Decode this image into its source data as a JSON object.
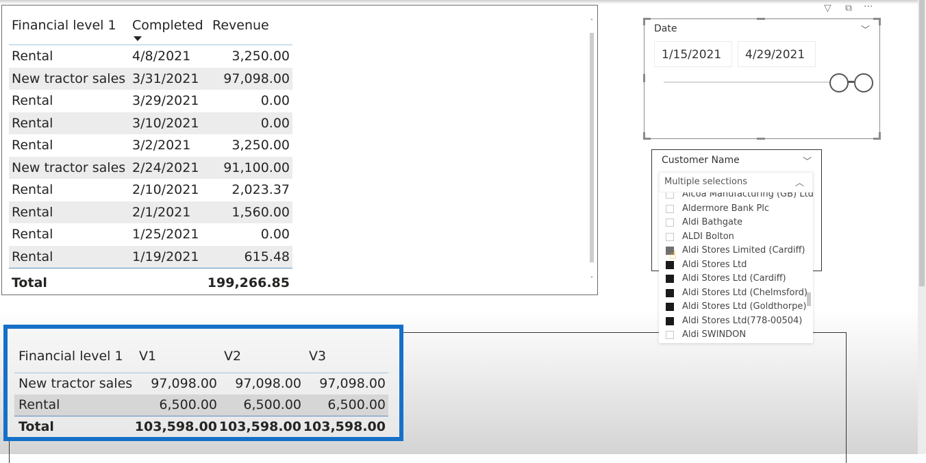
{
  "main_table": {
    "columns": [
      "Financial level 1",
      "Completed",
      "Revenue"
    ],
    "sorted_column": "Completed",
    "rows": [
      {
        "level": "Rental",
        "completed": "4/8/2021",
        "revenue": "3,250.00"
      },
      {
        "level": "New tractor sales",
        "completed": "3/31/2021",
        "revenue": "97,098.00"
      },
      {
        "level": "Rental",
        "completed": "3/29/2021",
        "revenue": "0.00"
      },
      {
        "level": "Rental",
        "completed": "3/10/2021",
        "revenue": "0.00"
      },
      {
        "level": "Rental",
        "completed": "3/2/2021",
        "revenue": "3,250.00"
      },
      {
        "level": "New tractor sales",
        "completed": "2/24/2021",
        "revenue": "91,100.00"
      },
      {
        "level": "Rental",
        "completed": "2/10/2021",
        "revenue": "2,023.37"
      },
      {
        "level": "Rental",
        "completed": "2/1/2021",
        "revenue": "1,560.00"
      },
      {
        "level": "Rental",
        "completed": "1/25/2021",
        "revenue": "0.00"
      },
      {
        "level": "Rental",
        "completed": "1/19/2021",
        "revenue": "615.48"
      }
    ],
    "total_label": "Total",
    "total_revenue": "199,266.85"
  },
  "date_slicer": {
    "title": "Date",
    "start": "1/15/2021",
    "end": "4/29/2021",
    "icons": [
      "filter-icon",
      "focus-mode-icon",
      "more-options-icon"
    ],
    "icon_glyphs": {
      "filter": "▽",
      "focus": "⧉",
      "more": "···"
    }
  },
  "customer_slicer": {
    "title": "Customer Name",
    "dropdown_value": "Multiple selections",
    "items": [
      {
        "label": "Alcoa Manufacturing (GB) Ltd",
        "state": "off"
      },
      {
        "label": "Aldermore Bank Plc",
        "state": "off"
      },
      {
        "label": "Aldi Bathgate",
        "state": "off"
      },
      {
        "label": "ALDI Bolton",
        "state": "off"
      },
      {
        "label": "Aldi Stores Limited (Cardiff)",
        "state": "hover"
      },
      {
        "label": "Aldi Stores Ltd",
        "state": "on"
      },
      {
        "label": "Aldi Stores Ltd (Cardiff)",
        "state": "on"
      },
      {
        "label": "Aldi Stores Ltd (Chelmsford)",
        "state": "on"
      },
      {
        "label": "Aldi Stores Ltd (Goldthorpe)",
        "state": "on"
      },
      {
        "label": "Aldi Stores Ltd(778-00504)",
        "state": "on"
      },
      {
        "label": "Aldi SWINDON",
        "state": "off"
      }
    ]
  },
  "summary_table": {
    "columns": [
      "Financial level 1",
      "V1",
      "V2",
      "V3"
    ],
    "rows": [
      {
        "level": "New tractor sales",
        "v1": "97,098.00",
        "v2": "97,098.00",
        "v3": "97,098.00"
      },
      {
        "level": "Rental",
        "v1": "6,500.00",
        "v2": "6,500.00",
        "v3": "6,500.00"
      }
    ],
    "total": {
      "label": "Total",
      "v1": "103,598.00",
      "v2": "103,598.00",
      "v3": "103,598.00"
    },
    "highlight_color": "#1670c8"
  }
}
